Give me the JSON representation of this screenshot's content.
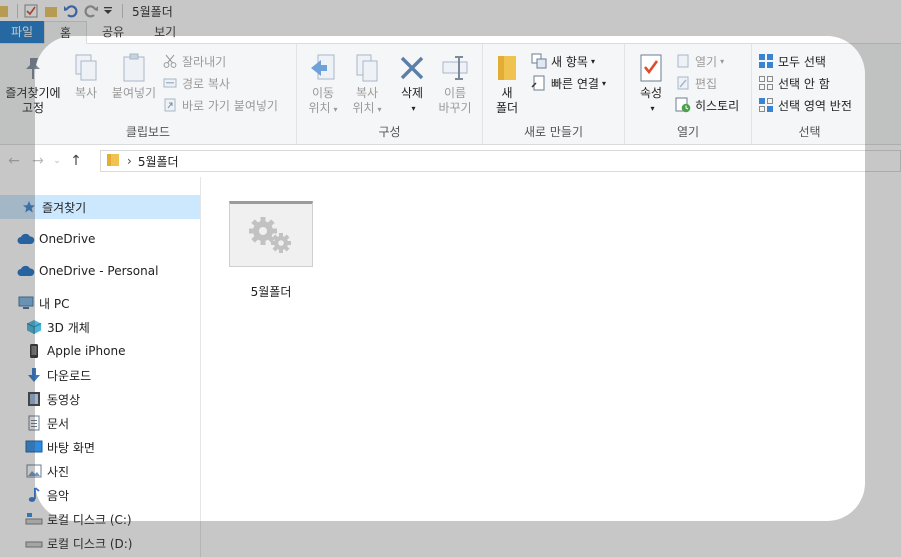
{
  "window": {
    "title": "5월폴더"
  },
  "tabs": [
    {
      "label": "파일"
    },
    {
      "label": "홈"
    },
    {
      "label": "공유"
    },
    {
      "label": "보기"
    }
  ],
  "ribbon": {
    "clipboard": {
      "label": "클립보드",
      "pin": "즐겨찾기에",
      "pin2": "고정",
      "copy": "복사",
      "paste": "붙여넣기",
      "cut": "잘라내기",
      "copy_path": "경로 복사",
      "paste_shortcut": "바로 가기 붙여넣기"
    },
    "organize": {
      "label": "구성",
      "move_to": "이동",
      "move_to2": "위치",
      "copy_to": "복사",
      "copy_to2": "위치",
      "delete": "삭제",
      "rename": "이름",
      "rename2": "바꾸기"
    },
    "new": {
      "label": "새로 만들기",
      "new_folder": "새",
      "new_folder2": "폴더",
      "new_item": "새 항목",
      "easy_access": "빠른 연결"
    },
    "open": {
      "label": "열기",
      "properties": "속성",
      "open": "열기",
      "edit": "편집",
      "history": "히스토리"
    },
    "select": {
      "label": "선택",
      "select_all": "모두 선택",
      "select_none": "선택 안 함",
      "invert": "선택 영역 반전"
    }
  },
  "address": {
    "path": "5월폴더"
  },
  "navpane": [
    {
      "label": "즐겨찾기",
      "icon": "star-icon"
    },
    {
      "label": "OneDrive",
      "icon": "cloud-icon"
    },
    {
      "label": "OneDrive - Personal",
      "icon": "cloud-icon"
    },
    {
      "label": "내 PC",
      "icon": "computer-icon"
    },
    {
      "label": "3D 개체",
      "icon": "cube-icon"
    },
    {
      "label": "Apple iPhone",
      "icon": "phone-icon"
    },
    {
      "label": "다운로드",
      "icon": "download-icon"
    },
    {
      "label": "동영상",
      "icon": "video-icon"
    },
    {
      "label": "문서",
      "icon": "document-icon"
    },
    {
      "label": "바탕 화면",
      "icon": "desktop-icon"
    },
    {
      "label": "사진",
      "icon": "picture-icon"
    },
    {
      "label": "음악",
      "icon": "music-icon"
    },
    {
      "label": "로컬 디스크 (C:)",
      "icon": "drive-icon"
    },
    {
      "label": "로컬 디스크 (D:)",
      "icon": "drive-icon"
    }
  ],
  "content": {
    "items": [
      {
        "name": "5월폴더",
        "icon": "settings-gears-icon"
      }
    ]
  },
  "colors": {
    "file_tab": "#1979ca",
    "selected_nav": "#cce8ff",
    "accent_red": "#e04a2a"
  }
}
